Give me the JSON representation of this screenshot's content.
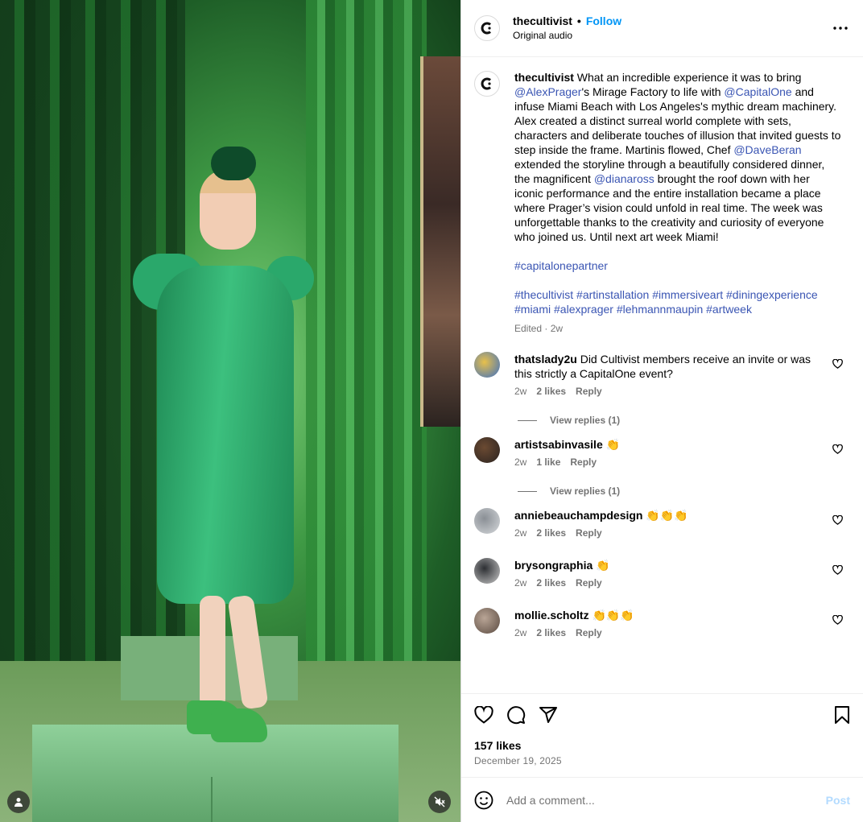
{
  "post": {
    "username": "thecultivist",
    "dot": "•",
    "follow_label": "Follow",
    "audio": "Original audio",
    "caption": {
      "username": "thecultivist",
      "parts": [
        {
          "t": "text",
          "v": " What an incredible experience it was to bring "
        },
        {
          "t": "mention",
          "v": "@AlexPrager"
        },
        {
          "t": "text",
          "v": "'s Mirage Factory to life with "
        },
        {
          "t": "mention",
          "v": "@CapitalOne"
        },
        {
          "t": "text",
          "v": " and infuse Miami Beach with Los Angeles's mythic dream machinery. Alex created a distinct surreal world complete with sets, characters and deliberate touches of illusion that invited guests to step inside the frame. Martinis flowed, Chef "
        },
        {
          "t": "mention",
          "v": "@DaveBeran"
        },
        {
          "t": "text",
          "v": " extended the storyline through a beautifully considered dinner, the magnificent "
        },
        {
          "t": "mention",
          "v": "@dianaross"
        },
        {
          "t": "text",
          "v": " brought the roof down with her iconic performance and the entire installation became a place where Prager’s vision could unfold in real time. The week was unforgettable thanks to the creativity and curiosity of everyone who joined us. Until next art week Miami!"
        }
      ],
      "hashtag_line1": "#capitalonepartner",
      "hashtags": [
        "#thecultivist",
        "#artinstallation",
        "#immersiveart",
        "#diningexperience",
        "#miami",
        "#alexprager",
        "#lehmannmaupin",
        "#artweek"
      ],
      "meta": "Edited · 2w"
    }
  },
  "comments": [
    {
      "user": "thatslady2u",
      "text": " Did Cultivist members receive an invite or was this strictly a CapitalOne event?",
      "age": "2w",
      "likes": "2 likes",
      "reply": "Reply",
      "view_replies": "View replies (1)"
    },
    {
      "user": "artistsabinvasile",
      "text": " 👏",
      "age": "2w",
      "likes": "1 like",
      "reply": "Reply",
      "view_replies": "View replies (1)"
    },
    {
      "user": "anniebeauchampdesign",
      "text": " 👏👏👏",
      "age": "2w",
      "likes": "2 likes",
      "reply": "Reply"
    },
    {
      "user": "brysongraphia",
      "text": " 👏",
      "age": "2w",
      "likes": "2 likes",
      "reply": "Reply"
    },
    {
      "user": "mollie.scholtz",
      "text": " 👏👏👏",
      "age": "2w",
      "likes": "2 likes",
      "reply": "Reply"
    }
  ],
  "footer": {
    "likes": "157 likes",
    "date": "December 19, 2025",
    "add_comment_placeholder": "Add a comment...",
    "post_label": "Post"
  },
  "icons": [
    "more-icon",
    "heart-icon",
    "comment-icon",
    "share-icon",
    "bookmark-icon",
    "emoji-icon",
    "user-tag-icon",
    "mute-icon"
  ],
  "colors": {
    "link": "#0095f6",
    "mention": "#3a55b3",
    "muted": "#737373",
    "post_disabled": "#b3dbff"
  }
}
